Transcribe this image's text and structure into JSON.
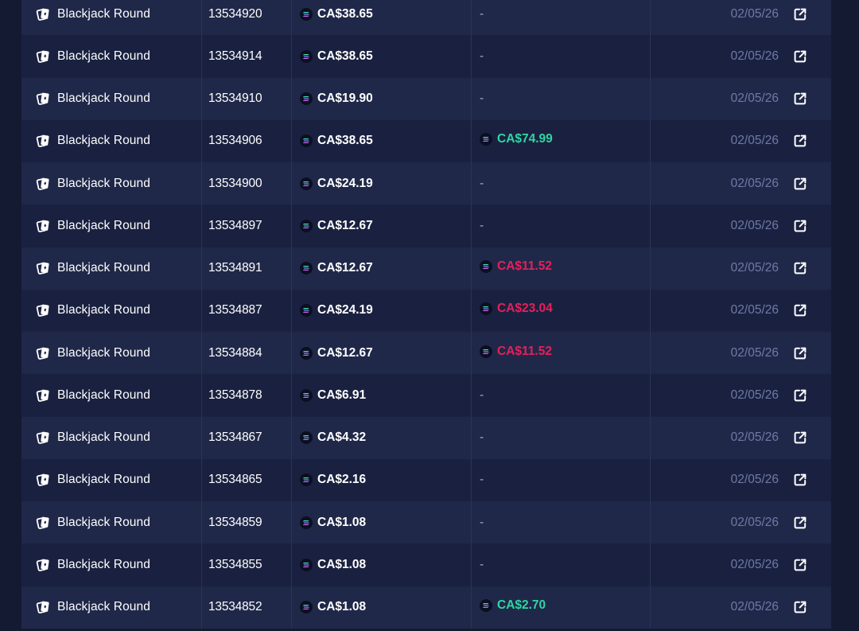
{
  "rows": [
    {
      "game": "Blackjack Round",
      "id": "13534920",
      "bet": "CA$38.65",
      "payout": "-",
      "payout_type": "none",
      "date": "02/05/26"
    },
    {
      "game": "Blackjack Round",
      "id": "13534914",
      "bet": "CA$38.65",
      "payout": "-",
      "payout_type": "none",
      "date": "02/05/26"
    },
    {
      "game": "Blackjack Round",
      "id": "13534910",
      "bet": "CA$19.90",
      "payout": "-",
      "payout_type": "none",
      "date": "02/05/26"
    },
    {
      "game": "Blackjack Round",
      "id": "13534906",
      "bet": "CA$38.65",
      "payout": "CA$74.99",
      "payout_type": "win",
      "date": "02/05/26"
    },
    {
      "game": "Blackjack Round",
      "id": "13534900",
      "bet": "CA$24.19",
      "payout": "-",
      "payout_type": "none",
      "date": "02/05/26"
    },
    {
      "game": "Blackjack Round",
      "id": "13534897",
      "bet": "CA$12.67",
      "payout": "-",
      "payout_type": "none",
      "date": "02/05/26"
    },
    {
      "game": "Blackjack Round",
      "id": "13534891",
      "bet": "CA$12.67",
      "payout": "CA$11.52",
      "payout_type": "loss",
      "date": "02/05/26"
    },
    {
      "game": "Blackjack Round",
      "id": "13534887",
      "bet": "CA$24.19",
      "payout": "CA$23.04",
      "payout_type": "loss",
      "date": "02/05/26"
    },
    {
      "game": "Blackjack Round",
      "id": "13534884",
      "bet": "CA$12.67",
      "payout": "CA$11.52",
      "payout_type": "loss",
      "date": "02/05/26"
    },
    {
      "game": "Blackjack Round",
      "id": "13534878",
      "bet": "CA$6.91",
      "payout": "-",
      "payout_type": "none",
      "date": "02/05/26"
    },
    {
      "game": "Blackjack Round",
      "id": "13534867",
      "bet": "CA$4.32",
      "payout": "-",
      "payout_type": "none",
      "date": "02/05/26"
    },
    {
      "game": "Blackjack Round",
      "id": "13534865",
      "bet": "CA$2.16",
      "payout": "-",
      "payout_type": "none",
      "date": "02/05/26"
    },
    {
      "game": "Blackjack Round",
      "id": "13534859",
      "bet": "CA$1.08",
      "payout": "-",
      "payout_type": "none",
      "date": "02/05/26"
    },
    {
      "game": "Blackjack Round",
      "id": "13534855",
      "bet": "CA$1.08",
      "payout": "-",
      "payout_type": "none",
      "date": "02/05/26"
    },
    {
      "game": "Blackjack Round",
      "id": "13534852",
      "bet": "CA$1.08",
      "payout": "CA$2.70",
      "payout_type": "win",
      "date": "02/05/26"
    }
  ],
  "icons": {
    "game": "playing-cards-icon",
    "currency": "solana-coin-icon",
    "action": "external-link-icon"
  },
  "colors": {
    "win": "#2fd6a2",
    "loss": "#e5205a",
    "date": "#6f7aa6"
  }
}
